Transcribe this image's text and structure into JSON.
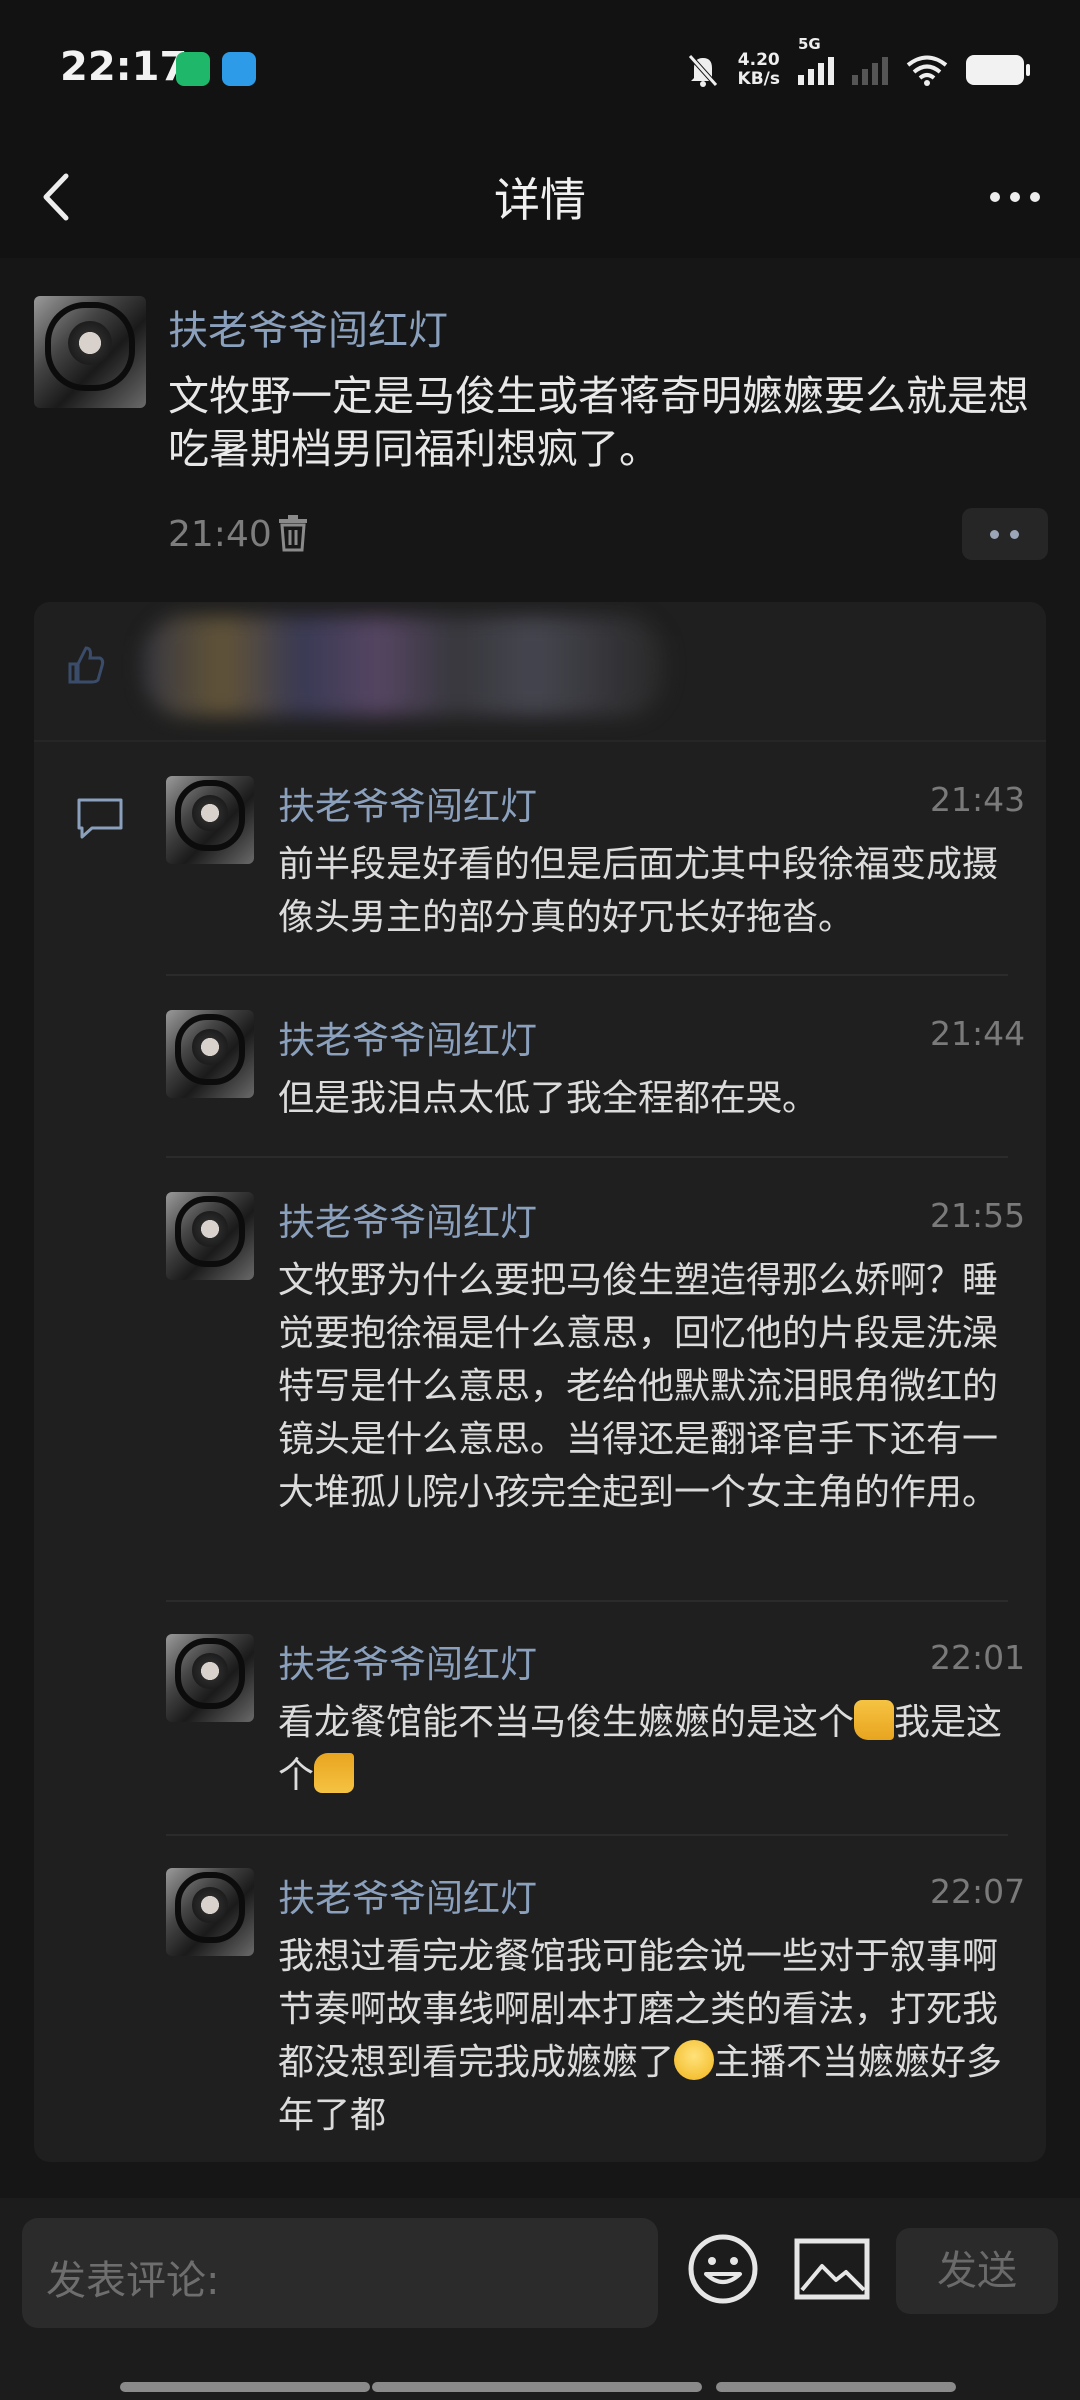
{
  "status_bar": {
    "time": "22:17",
    "net_speed": "4.20",
    "net_unit": "KB/s",
    "network": "5G"
  },
  "header": {
    "title": "详情"
  },
  "post": {
    "author": "扶老爷爷闯红灯",
    "text": "文牧野一定是马俊生或者蒋奇明嬷嬷要么就是想吃暑期档男同福利想疯了。",
    "time": "21:40"
  },
  "replies": [
    {
      "author": "扶老爷爷闯红灯",
      "time": "21:43",
      "text": "前半段是好看的但是后面尤其中段徐福变成摄像头男主的部分真的好冗长好拖沓。"
    },
    {
      "author": "扶老爷爷闯红灯",
      "time": "21:44",
      "text": "但是我泪点太低了我全程都在哭。"
    },
    {
      "author": "扶老爷爷闯红灯",
      "time": "21:55",
      "text": "文牧野为什么要把马俊生塑造得那么娇啊？睡觉要抱徐福是什么意思，回忆他的片段是洗澡特写是什么意思，老给他默默流泪眼角微红的镜头是什么意思。当得还是翻译官手下还有一大堆孤儿院小孩完全起到一个女主角的作用。"
    },
    {
      "author": "扶老爷爷闯红灯",
      "time": "22:01",
      "text_a": "看龙餐馆能不当马俊生嬷嬷的是这个",
      "text_b": "我是这个"
    },
    {
      "author": "扶老爷爷闯红灯",
      "time": "22:07",
      "text_a": "我想过看完龙餐馆我可能会说一些对于叙事啊节奏啊故事线啊剧本打磨之类的看法，打死我都没想到看完我成嬷嬷了",
      "text_b": "主播不当嬷嬷好多年了都"
    }
  ],
  "composer": {
    "placeholder": "发表评论:",
    "send_label": "发送"
  },
  "colors": {
    "accent_name": "#8aa0bd",
    "background": "#161616",
    "card": "#1f1f1f"
  }
}
